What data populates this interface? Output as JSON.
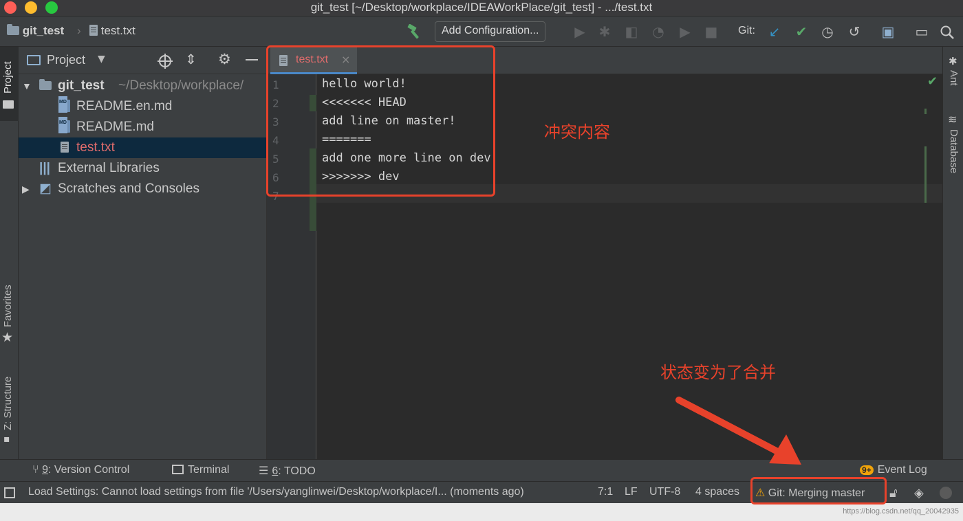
{
  "window": {
    "title": "git_test [~/Desktop/workplace/IDEAWorkPlace/git_test] - .../test.txt"
  },
  "toolbar": {
    "breadcrumb_project": "git_test",
    "breadcrumb_file": "test.txt",
    "add_configuration": "Add Configuration...",
    "git_label": "Git:"
  },
  "left_strip": {
    "project": "Project",
    "favorites": "Favorites",
    "structure": "Z: Structure"
  },
  "project_panel": {
    "header": "Project",
    "root_name": "git_test",
    "root_path": "~/Desktop/workplace/",
    "files": [
      "README.en.md",
      "README.md",
      "test.txt"
    ],
    "external_libraries": "External Libraries",
    "scratches": "Scratches and Consoles"
  },
  "editor": {
    "tab_name": "test.txt",
    "line_numbers": [
      "1",
      "2",
      "3",
      "4",
      "5",
      "6",
      "7"
    ],
    "lines": [
      "hello world!",
      "<<<<<<< HEAD",
      "add line on master!",
      "=======",
      "add one more line on dev!",
      ">>>>>>> dev",
      ""
    ]
  },
  "right_strip": {
    "ant": "Ant",
    "database": "Database"
  },
  "bottom_tools": {
    "version_control_num": "9",
    "version_control": ": Version Control",
    "terminal": "Terminal",
    "todo_num": "6",
    "todo": ": TODO",
    "event_badge": "9+",
    "event_log": "Event Log"
  },
  "status": {
    "message": "Load Settings: Cannot load settings from file '/Users/yanglinwei/Desktop/workplace/I... (moments ago)",
    "position": "7:1",
    "line_sep": "LF",
    "encoding": "UTF-8",
    "indent": "4 spaces",
    "git_status": "Git: Merging master"
  },
  "annotations": {
    "conflict": "冲突内容",
    "status_changed": "状态变为了合并"
  },
  "watermark": "https://blog.csdn.net/qq_20042935",
  "colors": {
    "annotation_red": "#e8422b",
    "selection": "#0d293e",
    "tab_active_text": "#e06c6c",
    "git_green": "#59a869",
    "git_blue": "#3592c4"
  }
}
